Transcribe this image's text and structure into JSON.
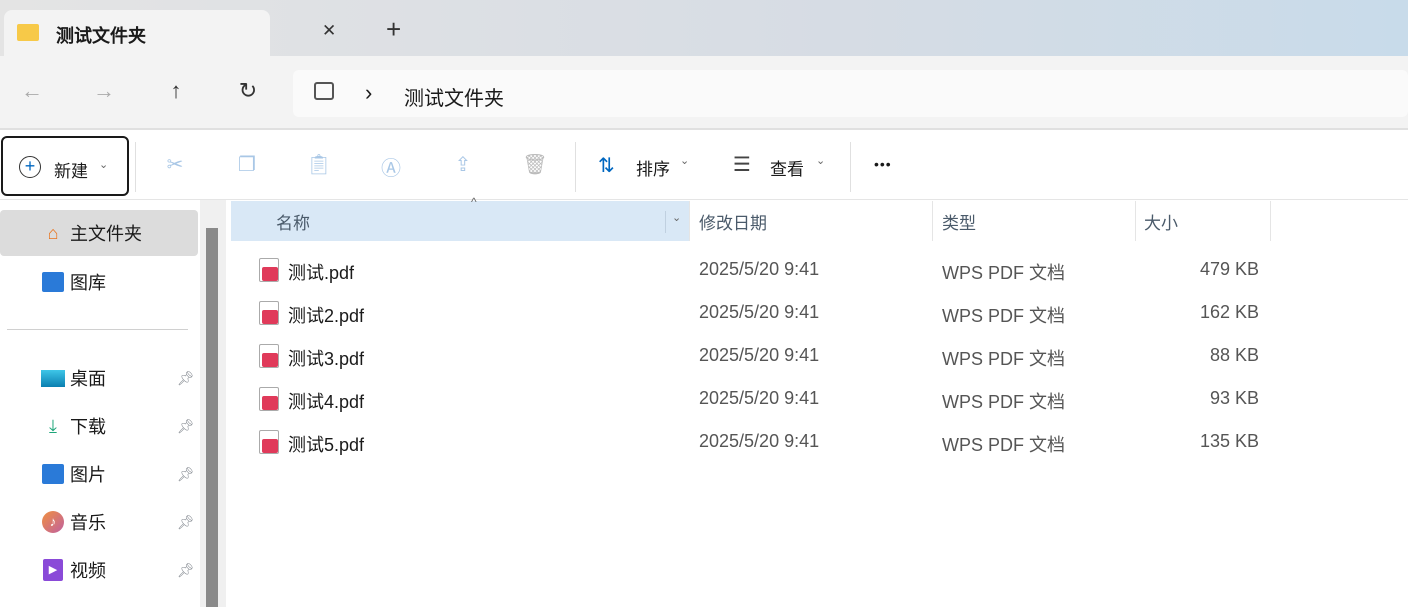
{
  "tab": {
    "title": "测试文件夹",
    "close": "✕",
    "new_tab": "+"
  },
  "nav": {
    "back": "←",
    "forward": "→",
    "up": "↑",
    "refresh": "↻",
    "breadcrumb_sep": "›",
    "location": "测试文件夹"
  },
  "toolbar": {
    "new_label": "新建",
    "sort_label": "排序",
    "view_label": "查看",
    "more": "•••"
  },
  "sidebar": {
    "top": [
      {
        "label": "主文件夹"
      },
      {
        "label": "图库"
      }
    ],
    "pinned": [
      {
        "label": "桌面"
      },
      {
        "label": "下载"
      },
      {
        "label": "图片"
      },
      {
        "label": "音乐"
      },
      {
        "label": "视频"
      }
    ]
  },
  "columns": {
    "name": "名称",
    "date": "修改日期",
    "type": "类型",
    "size": "大小"
  },
  "files": [
    {
      "name": "测试.pdf",
      "date": "2025/5/20 9:41",
      "type": "WPS PDF 文档",
      "size": "479 KB"
    },
    {
      "name": "测试2.pdf",
      "date": "2025/5/20 9:41",
      "type": "WPS PDF 文档",
      "size": "162 KB"
    },
    {
      "name": "测试3.pdf",
      "date": "2025/5/20 9:41",
      "type": "WPS PDF 文档",
      "size": "88 KB"
    },
    {
      "name": "测试4.pdf",
      "date": "2025/5/20 9:41",
      "type": "WPS PDF 文档",
      "size": "93 KB"
    },
    {
      "name": "测试5.pdf",
      "date": "2025/5/20 9:41",
      "type": "WPS PDF 文档",
      "size": "135 KB"
    }
  ]
}
